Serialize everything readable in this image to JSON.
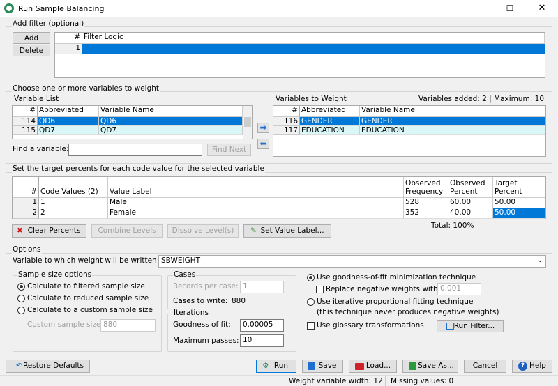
{
  "window": {
    "title": "Run Sample Balancing",
    "minimize": "—",
    "maximize": "☐",
    "close": "✕"
  },
  "filter": {
    "section_label": "Add filter (optional)",
    "add_label": "Add",
    "delete_label": "Delete",
    "header_num": "#",
    "header_logic": "Filter Logic",
    "rows": [
      {
        "num": "1",
        "logic": ""
      }
    ]
  },
  "variables": {
    "section_label": "Choose one or more variables to weight",
    "list_label": "Variable List",
    "headers": [
      "#",
      "Abbreviated",
      "Variable Name"
    ],
    "list_rows": [
      {
        "num": "114",
        "abbr": "QD6",
        "name": "QD6"
      },
      {
        "num": "115",
        "abbr": "QD7",
        "name": "QD7"
      }
    ],
    "weight_label": "Variables to Weight",
    "added_info": "Variables added: 2 | Maximum: 10",
    "weight_rows": [
      {
        "num": "116",
        "abbr": "GENDER",
        "name": "GENDER"
      },
      {
        "num": "117",
        "abbr": "EDUCATION",
        "name": "EDUCATION"
      }
    ],
    "find_label": "Find a variable:",
    "find_value": "",
    "find_next_label": "Find Next"
  },
  "targets": {
    "section_label": "Set the target percents for each code value for the selected variable",
    "headers": [
      "#",
      "Code Values (2)",
      "Value Label",
      "Observed Frequency",
      "Observed Percent",
      "Target Percent"
    ],
    "rows": [
      {
        "num": "1",
        "code": "1",
        "label": "Male",
        "freq": "528",
        "obs": "60.00",
        "target": "50.00"
      },
      {
        "num": "2",
        "code": "2",
        "label": "Female",
        "freq": "352",
        "obs": "40.00",
        "target": "50.00"
      }
    ],
    "clear_label": "Clear Percents",
    "combine_label": "Combine Levels",
    "dissolve_label": "Dissolve Level(s)",
    "set_value_label": "Set Value Label...",
    "total": "Total: 100%"
  },
  "options": {
    "section_label": "Options",
    "weight_var_label": "Variable to which weight will be written:",
    "weight_var_value": "SBWEIGHT",
    "sample_label": "Sample size options",
    "radio_filtered": "Calculate to filtered sample size",
    "radio_reduced": "Calculate to reduced sample size",
    "radio_custom": "Calculate to a custom sample size",
    "custom_label": "Custom sample size:",
    "custom_value": "880",
    "cases_label": "Cases",
    "records_label": "Records per case:",
    "records_value": "1",
    "cases_write_label": "Cases to write:",
    "cases_write_value": "880",
    "iter_label": "Iterations",
    "gof_label": "Goodness of fit:",
    "gof_value": "0.00005",
    "maxpass_label": "Maximum passes:",
    "maxpass_value": "10",
    "gof_tech": "Use goodness-of-fit minimization technique",
    "replace_neg": "Replace negative weights with:",
    "replace_value": "0.001",
    "ipf_tech": "Use iterative proportional fitting technique",
    "ipf_note": "(this technique never produces negative weights)",
    "glossary": "Use glossary transformations",
    "run_filter": "Run Filter..."
  },
  "buttons": {
    "restore": "Restore Defaults",
    "run": "Run",
    "save": "Save",
    "load": "Load...",
    "save_as": "Save As...",
    "cancel": "Cancel",
    "help": "Help"
  },
  "status": {
    "width": "Weight variable width: 12",
    "missing": "Missing values: 0"
  }
}
